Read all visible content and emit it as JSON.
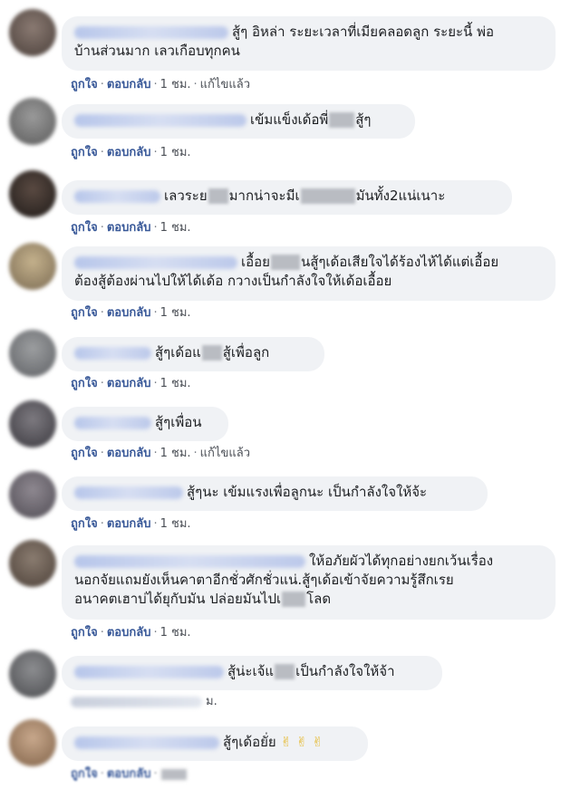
{
  "comments": [
    {
      "text_line1": "สู้ๆ อิหล่า ระยะเวลาที่เมียคลอดลูก ระยะนี้ พ่อ",
      "text_line2": "บ้านส่วนมาก เลวเกือบทุกคน",
      "like": "ถูกใจ",
      "reply": "ตอบกลับ",
      "time": "1 ชม.",
      "edited": "แก้ไขแล้ว"
    },
    {
      "text_a": "เข้มแข็งเด้อพี่",
      "text_b": "สู้ๆ",
      "like": "ถูกใจ",
      "reply": "ตอบกลับ",
      "time": "1 ชม."
    },
    {
      "text_a": "เลวระย",
      "text_b": "มากน่าจะมีเ",
      "text_c": "มันทั้ง2แน่เนาะ",
      "like": "ถูกใจ",
      "reply": "ตอบกลับ",
      "time": "1 ชม."
    },
    {
      "text_a": "เอื้อย",
      "text_b": "นสู้ๆเด้อเสียใจได้ร้องไห้ได้แต่เอื้อย",
      "text_line2": "ต้องสู้ต้องผ่านไปให้ได้เด้อ กวางเป็นกำลังใจให้เด้อเอื้อย",
      "like": "ถูกใจ",
      "reply": "ตอบกลับ",
      "time": "1 ชม."
    },
    {
      "text_a": "สู้ๆเด้อแ",
      "text_b": "สู้เพื่อลูก",
      "like": "ถูกใจ",
      "reply": "ตอบกลับ",
      "time": "1 ชม."
    },
    {
      "text_a": "สู้ๆเพื่อน",
      "like": "ถูกใจ",
      "reply": "ตอบกลับ",
      "time": "1 ชม.",
      "edited": "แก้ไขแล้ว"
    },
    {
      "text_a": "สู้ๆนะ เข้มแรงเพื่อลูกนะ เป็นกำลังใจให้จ้ะ",
      "like": "ถูกใจ",
      "reply": "ตอบกลับ",
      "time": "1 ชม."
    },
    {
      "text_a": "ให้อภัยผัวได้ทุกอย่างยกเว้นเรื่อง",
      "text_line2": "นอกจัยแถมยังเห็นคาตาอีกชั่วศักชั่วแน่.สู้ๆเด้อเข้าจัยความรู้สึกเรย",
      "text_line3a": "อนาคตเฮาบ่ได้ยุกับมัน ปล่อยมันไปเ",
      "text_line3b": "โลด",
      "like": "ถูกใจ",
      "reply": "ตอบกลับ",
      "time": "1 ชม."
    },
    {
      "text_a": "สู้น่ะเจ้แ",
      "text_b": "เป็นกำลังใจให้จ้า",
      "time": "ม."
    },
    {
      "text_a": "สู้ๆเด้อยั่ย",
      "emojis": "✌ ✌ ✌",
      "like": "ถูกใจ",
      "reply": "ตอบกลับ"
    }
  ],
  "colors": {
    "bubble": "#f0f2f5",
    "link": "#385898",
    "text": "#1c1e21",
    "meta": "#4b4f56"
  }
}
